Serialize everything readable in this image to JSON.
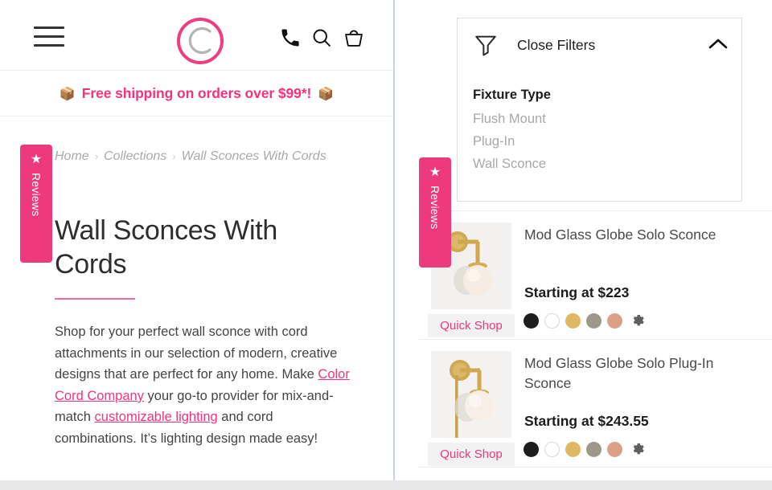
{
  "header": {
    "menu_icon": "hamburger-menu-icon",
    "logo_alt": "Color Cord Company logo",
    "icons": [
      {
        "name": "phone-icon",
        "label": "Call"
      },
      {
        "name": "search-icon",
        "label": "Search"
      },
      {
        "name": "shopping-bag-icon",
        "label": "Cart"
      }
    ]
  },
  "banner": {
    "emoji_left": "📦",
    "text": "Free shipping on orders over $99*!",
    "emoji_right": "📦",
    "color": "#f5327e"
  },
  "reviews_tab": {
    "label": "Reviews",
    "star": "★",
    "color": "#ed3a7f"
  },
  "breadcrumb": {
    "items": [
      "Home",
      "Collections",
      "Wall Sconces With Cords"
    ],
    "separator": "›"
  },
  "page": {
    "title": "Wall Sconces With Cords",
    "intro_segments": [
      {
        "type": "text",
        "value": "Shop for your perfect wall sconce with cord attachments in our selection of modern, creative designs that are perfect for any home. Make "
      },
      {
        "type": "link",
        "value": "Color Cord Company"
      },
      {
        "type": "text",
        "value": " your go-to provider for mix-and-match "
      },
      {
        "type": "link",
        "value": "customizable lighting"
      },
      {
        "type": "text",
        "value": " and cord combinations. It’s lighting design made easy!"
      }
    ]
  },
  "filters": {
    "title": "Close Filters",
    "funnel_icon": "funnel-icon",
    "toggle_icon": "chevron-up-icon",
    "groups": [
      {
        "title": "Fixture Type",
        "options": [
          "Flush Mount",
          "Plug-In",
          "Wall Sconce"
        ]
      }
    ]
  },
  "products": [
    {
      "title": "Mod Glass Globe Solo Sconce",
      "price": "Starting at $223",
      "quick_shop": "Quick Shop",
      "swatches": [
        {
          "name": "black",
          "color": "#1d1d1d"
        },
        {
          "name": "white",
          "color": "#ffffff"
        },
        {
          "name": "gold",
          "color": "#e0b861"
        },
        {
          "name": "nickel",
          "color": "#9e978b"
        },
        {
          "name": "copper",
          "color": "#dba087"
        }
      ],
      "more_icon": "gear-icon"
    },
    {
      "title": "Mod Glass Globe Solo Plug-In Sconce",
      "price": "Starting at $243.55",
      "quick_shop": "Quick Shop",
      "swatches": [
        {
          "name": "black",
          "color": "#1d1d1d"
        },
        {
          "name": "white",
          "color": "#ffffff"
        },
        {
          "name": "gold",
          "color": "#e0b861"
        },
        {
          "name": "nickel",
          "color": "#9e978b"
        },
        {
          "name": "copper",
          "color": "#dba087"
        }
      ],
      "more_icon": "gear-icon"
    }
  ]
}
